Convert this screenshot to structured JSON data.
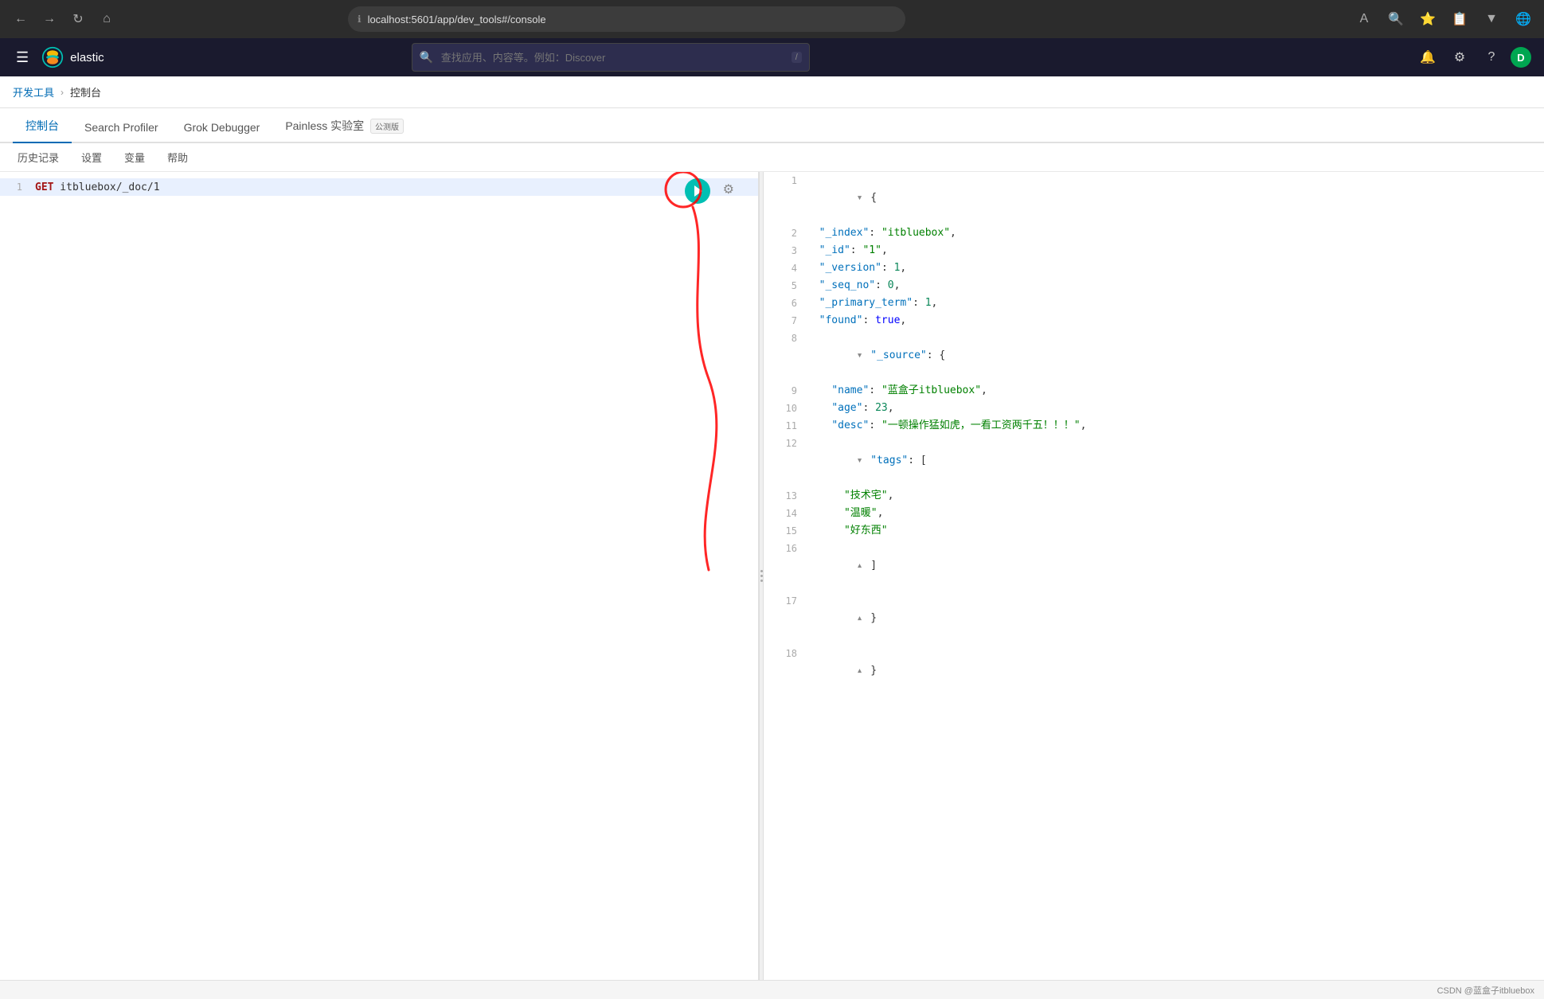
{
  "browser": {
    "url": "localhost:5601/app/dev_tools#/console",
    "info_icon": "ℹ",
    "back_label": "←",
    "forward_label": "→",
    "refresh_label": "↻",
    "home_label": "⌂"
  },
  "topbar": {
    "logo_text": "elastic",
    "search_placeholder": "查找应用、内容等。例如：Discover",
    "search_slash": "/",
    "hamburger_icon": "☰",
    "user_icon": "D"
  },
  "breadcrumb": {
    "items": [
      "开发工具",
      "控制台"
    ]
  },
  "tabs": [
    {
      "id": "console",
      "label": "控制台",
      "active": true
    },
    {
      "id": "search-profiler",
      "label": "Search Profiler",
      "active": false
    },
    {
      "id": "grok-debugger",
      "label": "Grok Debugger",
      "active": false
    },
    {
      "id": "painless-lab",
      "label": "Painless 实验室",
      "active": false,
      "badge": "公测版"
    }
  ],
  "toolbar": {
    "history_label": "历史记录",
    "settings_label": "设置",
    "variables_label": "变量",
    "help_label": "帮助"
  },
  "editor": {
    "line1": {
      "number": "1",
      "method": "GET",
      "path": " itbluebox/_doc/1"
    }
  },
  "result": {
    "lines": [
      {
        "num": "1",
        "fold": "▾",
        "content": "{",
        "type": "brace"
      },
      {
        "num": "2",
        "content": "  \"_index\": \"itbluebox\",",
        "key": "_index",
        "value": "itbluebox"
      },
      {
        "num": "3",
        "content": "  \"_id\": \"1\",",
        "key": "_id",
        "value": "1"
      },
      {
        "num": "4",
        "content": "  \"_version\": 1,",
        "key": "_version",
        "value": "1"
      },
      {
        "num": "5",
        "content": "  \"_seq_no\": 0,",
        "key": "_seq_no",
        "value": "0"
      },
      {
        "num": "6",
        "content": "  \"_primary_term\": 1,",
        "key": "_primary_term",
        "value": "1"
      },
      {
        "num": "7",
        "content": "  \"found\": true,",
        "key": "found",
        "value": "true"
      },
      {
        "num": "8",
        "fold": "▾",
        "content": "  \"_source\": {",
        "key": "_source"
      },
      {
        "num": "9",
        "content": "    \"name\": \"蓝盒子itbluebox\",",
        "key": "name",
        "value": "蓝盒子itbluebox"
      },
      {
        "num": "10",
        "content": "    \"age\": 23,",
        "key": "age",
        "value": "23"
      },
      {
        "num": "11",
        "content": "    \"desc\": \"一顿操作猛如虎，一看工资两千五！！！\",",
        "key": "desc",
        "value": "一顿操作猛如虎，一看工资两千五！！！"
      },
      {
        "num": "12",
        "fold": "▾",
        "content": "    \"tags\": [",
        "key": "tags"
      },
      {
        "num": "13",
        "content": "      \"技术宅\",",
        "value": "技术宅"
      },
      {
        "num": "14",
        "content": "      \"温暖\",",
        "value": "温暖"
      },
      {
        "num": "15",
        "content": "      \"好东西\"",
        "value": "好东西"
      },
      {
        "num": "16",
        "fold": "▴",
        "content": "    ]"
      },
      {
        "num": "17",
        "fold": "▴",
        "content": "  }"
      },
      {
        "num": "18",
        "fold": "▴",
        "content": "}"
      }
    ]
  },
  "footer": {
    "copyright": "CSDN @蓝盒子itbluebox"
  }
}
